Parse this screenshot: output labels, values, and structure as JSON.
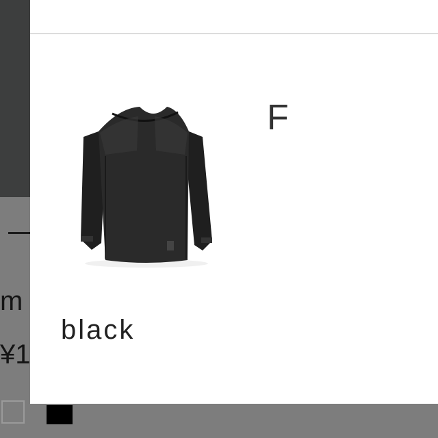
{
  "background": {
    "partial_name": "m",
    "partial_price": "¥1"
  },
  "modal": {
    "variant": {
      "color_label": "black",
      "image_icon": "black-long-sleeve-top-icon"
    },
    "size_label": "F"
  },
  "colors": {
    "overlay_dark": "#3d3e3e",
    "overlay_gray": "#7d7d7d",
    "modal_bg": "#ffffff",
    "text": "#222222"
  }
}
